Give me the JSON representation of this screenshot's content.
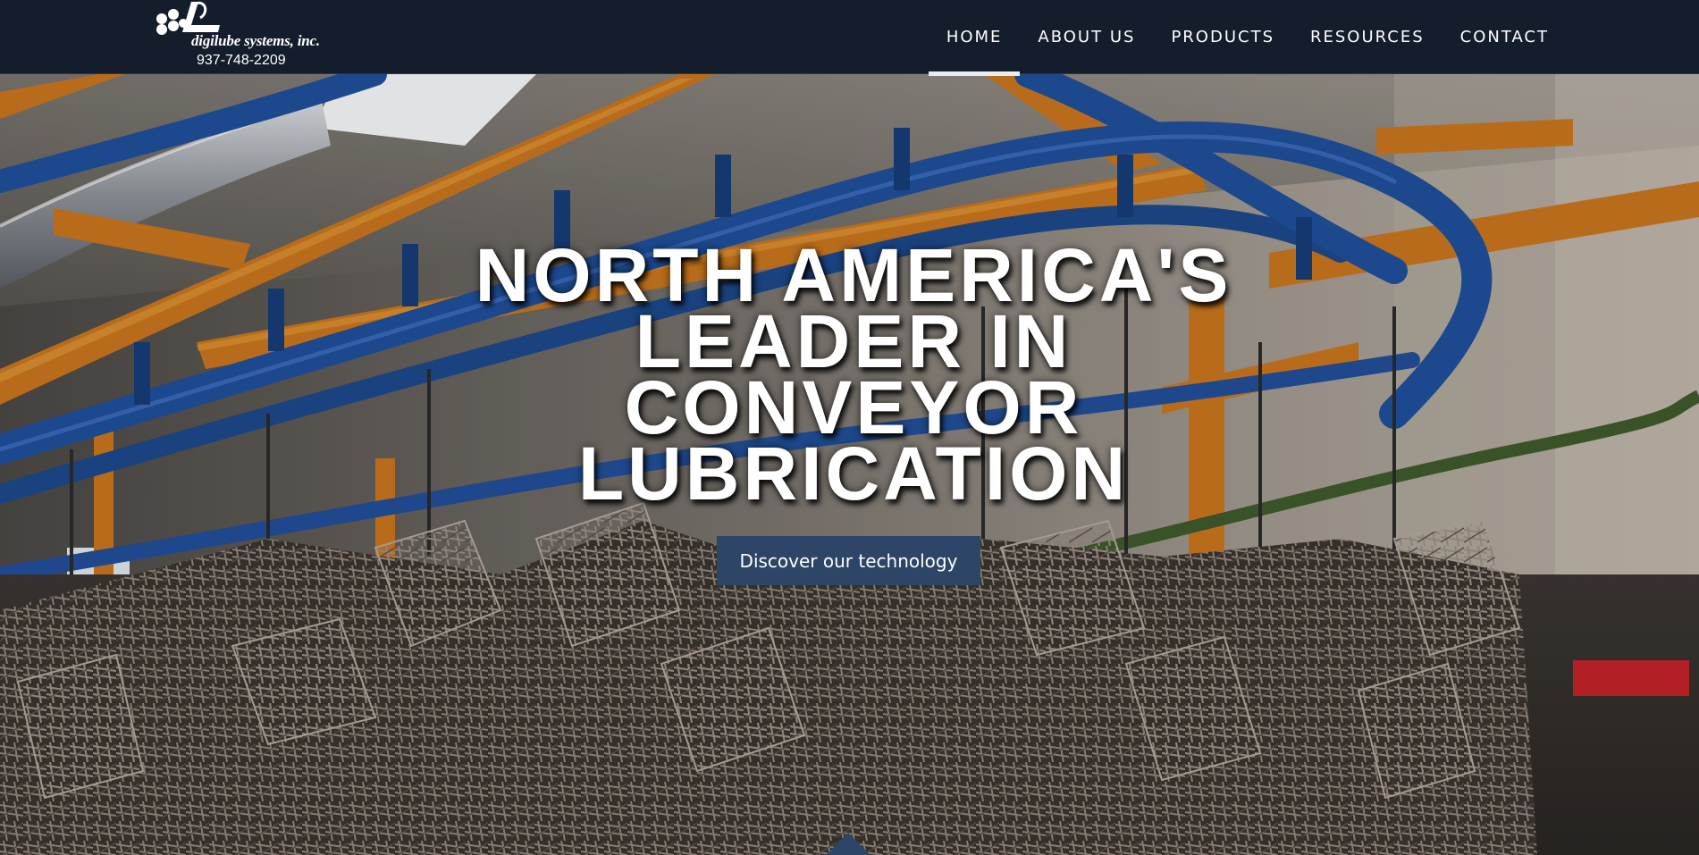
{
  "brand": {
    "name": "digilube systems, inc.",
    "phone": "937-748-2209"
  },
  "nav": {
    "items": [
      {
        "label": "HOME",
        "active": true
      },
      {
        "label": "ABOUT US",
        "active": false
      },
      {
        "label": "PRODUCTS",
        "active": false
      },
      {
        "label": "RESOURCES",
        "active": false
      },
      {
        "label": "CONTACT",
        "active": false
      }
    ]
  },
  "hero": {
    "title_lines": [
      "NORTH AMERICA'S",
      "LEADER IN",
      "CONVEYOR",
      "LUBRICATION"
    ],
    "cta_label": "Discover our technology"
  },
  "colors": {
    "header_bg": "#141d2b",
    "cta_bg": "#2d4566",
    "steel_blue": "#1f4f9a",
    "orange_beam": "#c8761e"
  }
}
